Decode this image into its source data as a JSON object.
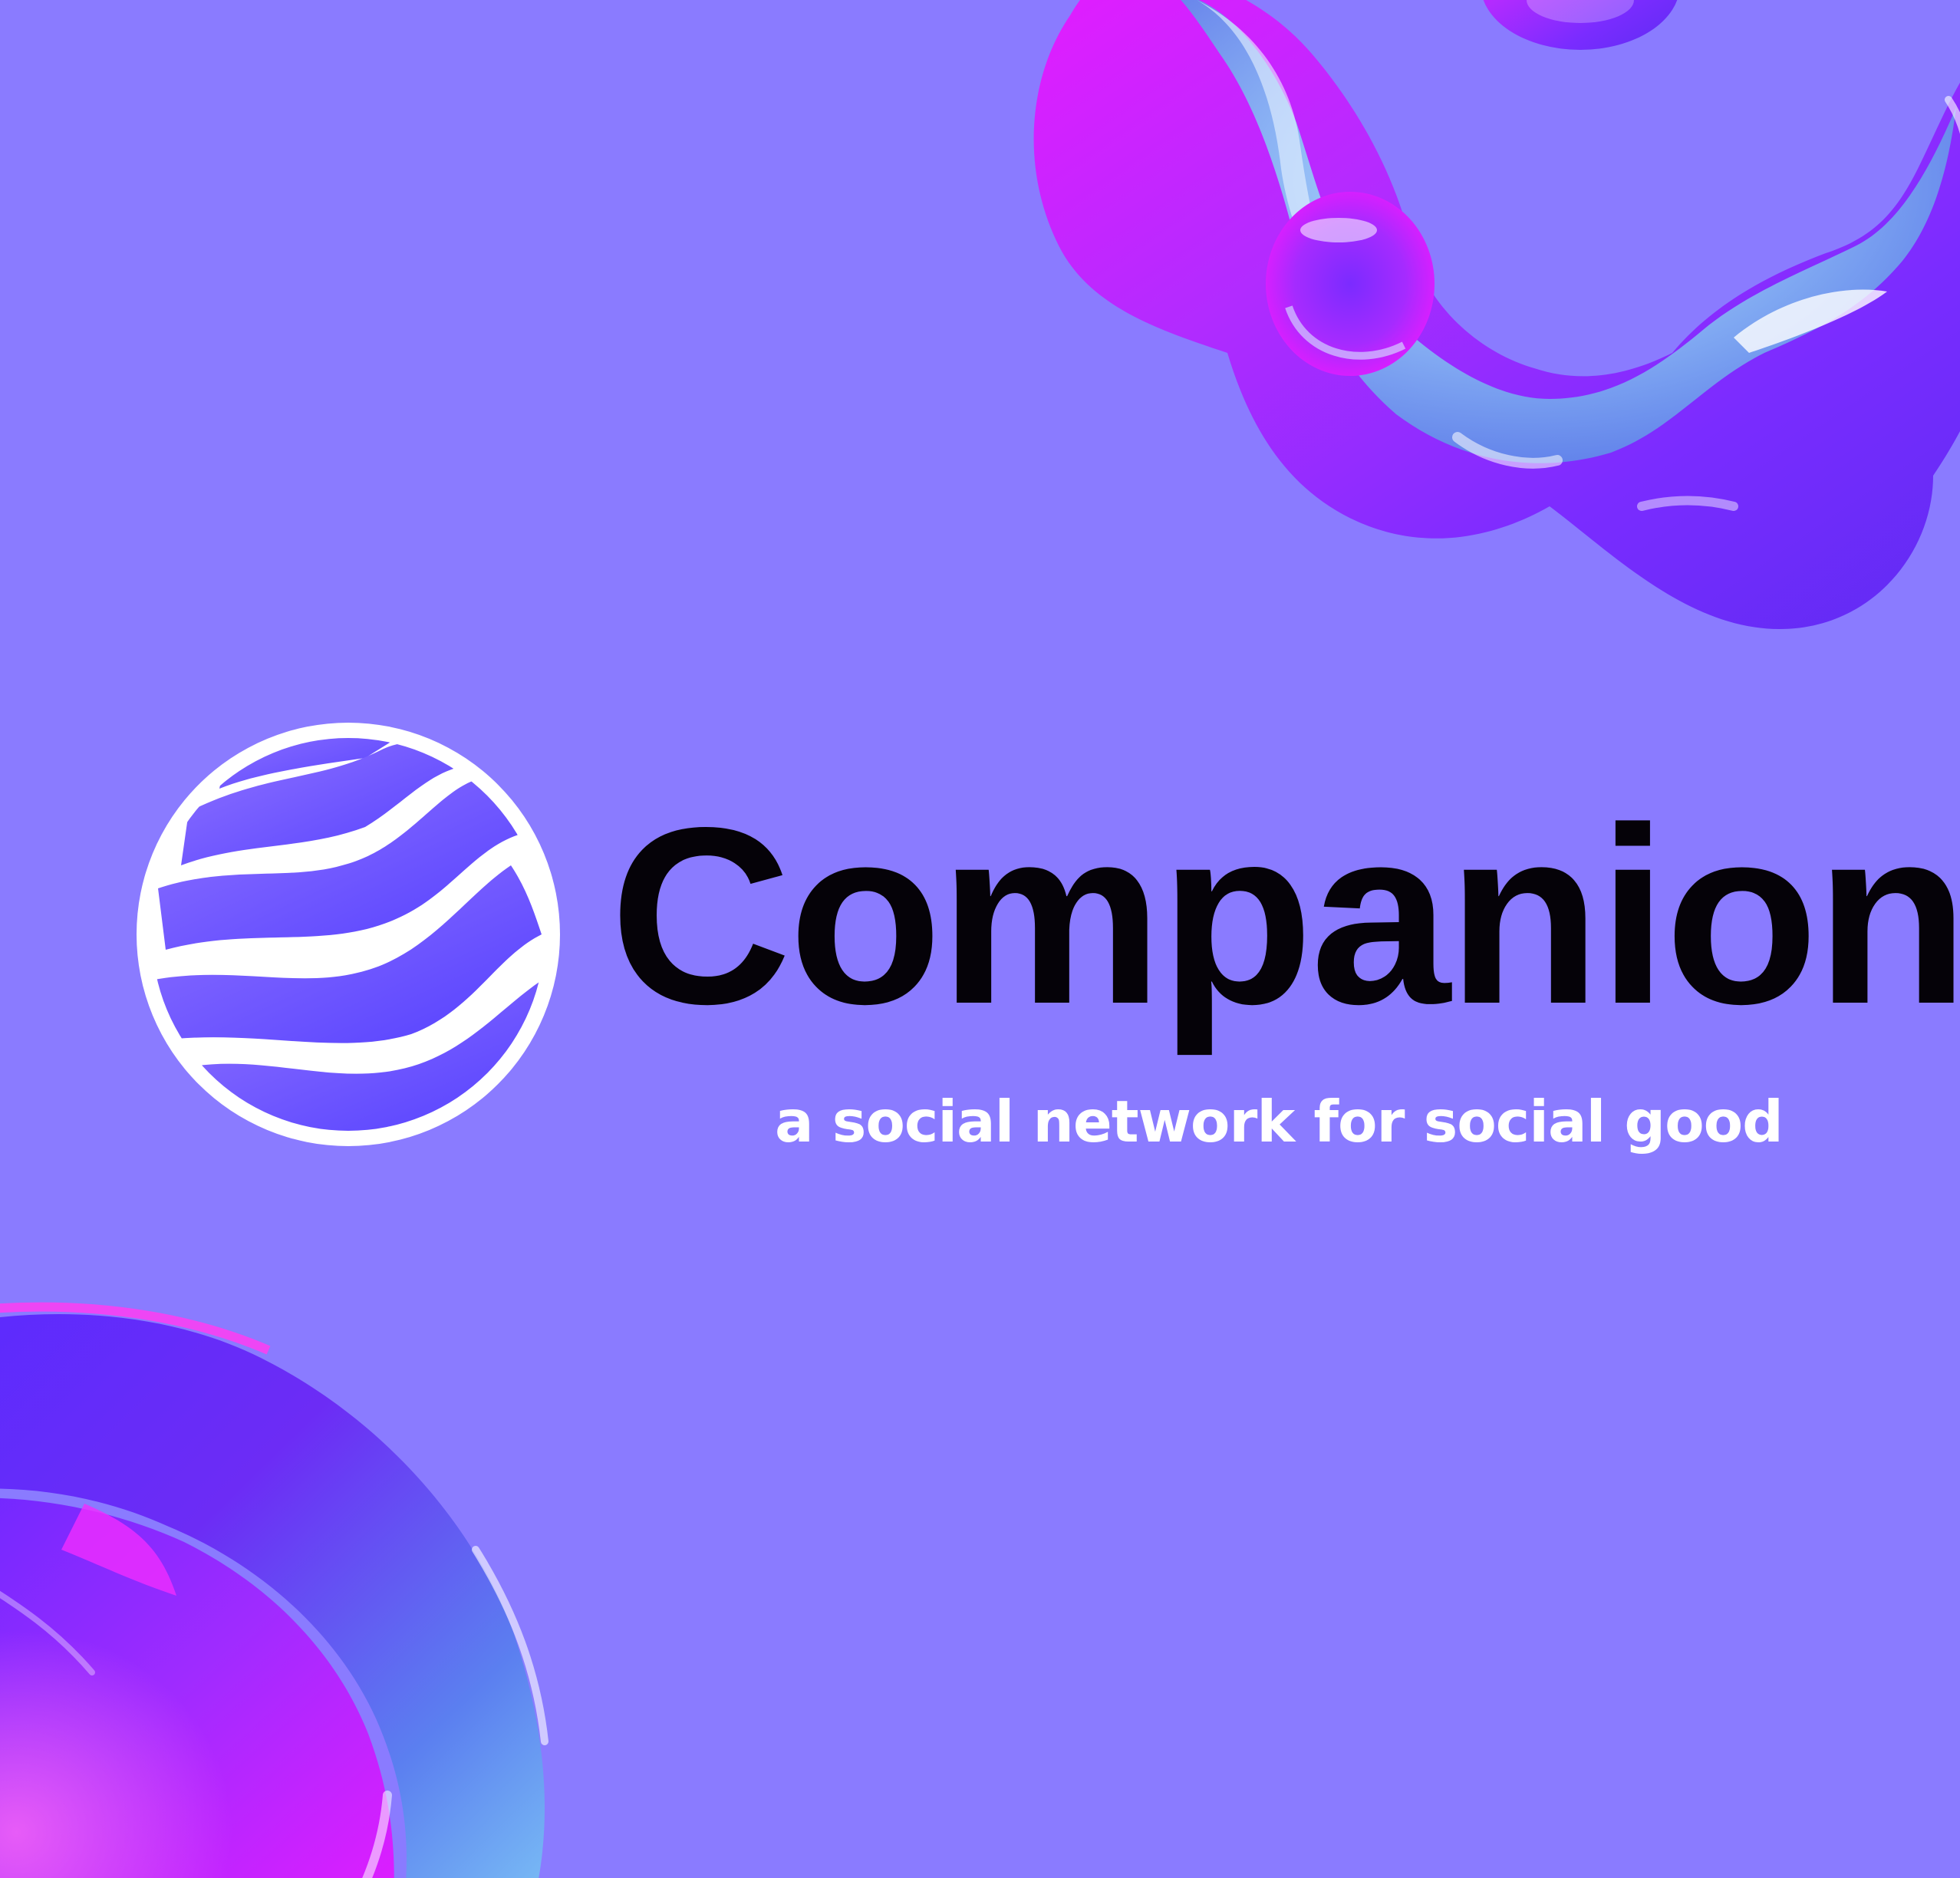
{
  "brand": {
    "name": "Companion",
    "tagline": "a social network for social good"
  },
  "colors": {
    "background": "#8a7bff",
    "wordmark": "#050208",
    "tagline": "#ffffff",
    "emblem_circle": "#ffffff",
    "emblem_stripes_start": "#8a6cff",
    "emblem_stripes_end": "#5a44ff",
    "blob_magenta": "#e01dff",
    "blob_violet": "#6a2cff",
    "blob_blue": "#6fb6f2"
  },
  "icons": {
    "logo": "globe-wave-stripes-icon",
    "decoration_top": "liquid-3d-blob",
    "decoration_bottom": "liquid-3d-ring"
  }
}
